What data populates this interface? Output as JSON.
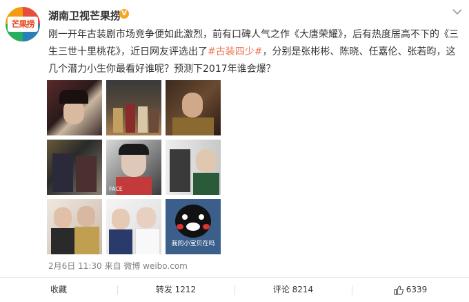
{
  "colors": {
    "accent": "#eb7350",
    "brand_orange": "#f5b61a",
    "link": "#eb7350"
  },
  "author": {
    "name": "湖南卫视芒果捞",
    "avatar_text": "芒果捞",
    "verified_badge": "V"
  },
  "post": {
    "text_part1": "刚一开年古装剧市场竞争便如此激烈，前有口碑人气之作《大唐荣耀》，后有热度居高不下的《三生三世十里桃花》，近日网友评选出了",
    "hashtag": "#古装四少#",
    "text_part2": "，分别是张彬彬、陈晓、任嘉伦、张若昀，这几个潜力小生你最看好谁呢？预测下2017年谁会爆？"
  },
  "images": {
    "thumb5_caption": "FACE",
    "thumb9_caption": "我的小宝贝在吗"
  },
  "meta": {
    "time": "2月6日 11:30",
    "source": "来自 微博 weibo.com"
  },
  "actions": {
    "favorite": "收藏",
    "repost": "转发 1212",
    "comment": "评论 8214",
    "like": "6339"
  }
}
